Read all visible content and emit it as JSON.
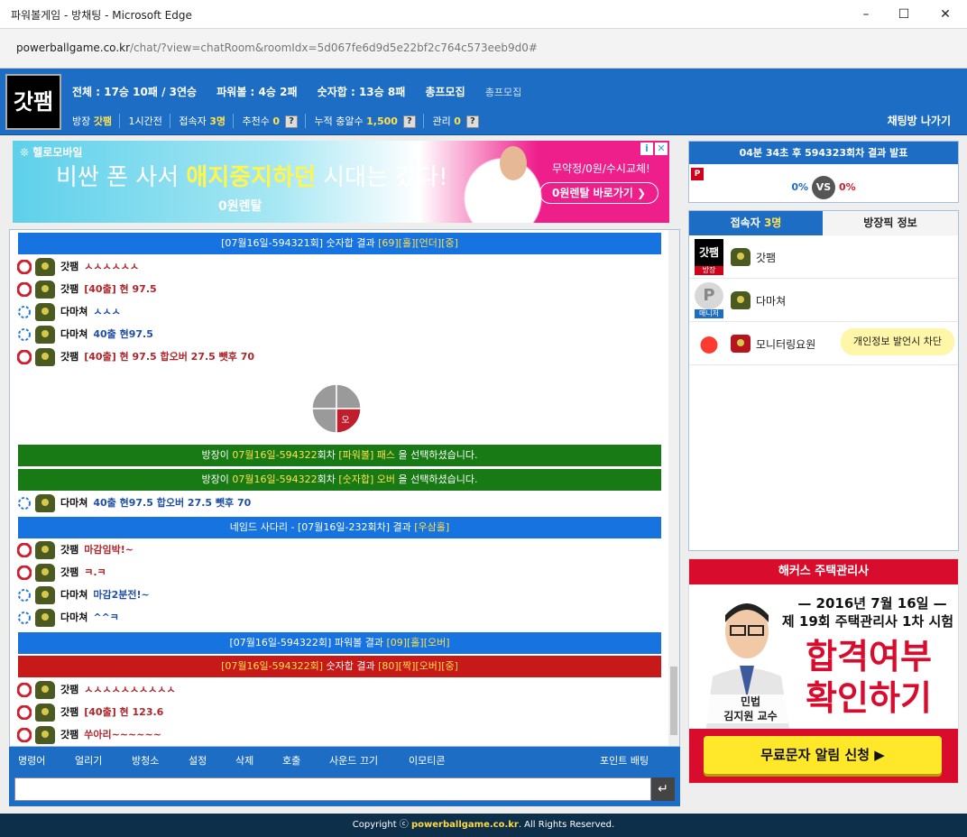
{
  "window": {
    "title": "파워볼게임 - 방채팅 - Microsoft Edge"
  },
  "address": {
    "host": "powerballgame.co.kr",
    "path": "/chat/?view=chatRoom&roomIdx=5d067fe6d9d5e22bf2c764c573eeb9d0#"
  },
  "header": {
    "logo_text": "갓팸",
    "stats": {
      "total": "전체 : 17승 10패 / 3연승",
      "powerball": "파워볼 : 4승 2패",
      "sum": "숫자합 : 13승 8패",
      "recruit": "총프모집",
      "recruit_dim": "총프모집"
    },
    "row2": {
      "host_label": "방장",
      "host_name": "갓팸",
      "time": "1시간전",
      "users_label": "접속자",
      "users_value": "3명",
      "recommend_label": "추천수",
      "recommend_value": "0",
      "cum_label": "누적 충알수",
      "cum_value": "1,500",
      "manage_label": "관리",
      "manage_value": "0",
      "q": "?"
    },
    "leave": "채팅방 나가기"
  },
  "ad_top": {
    "brand": "❊ 헬로모바일",
    "headline_pre": "비싼 폰 사서 ",
    "headline_em": "애지중지하던",
    "headline_post": " 시대는 갔다!",
    "sub": "0원렌탈",
    "right_text": "무약정/0원/수시교체!",
    "button": "0원렌탈 바로가기 ❯",
    "close": "✕"
  },
  "chat": {
    "sys1": {
      "pre": "[07월16일-594321회] 숫자합 결과 ",
      "em": "[69][홀][언더][중]"
    },
    "m1": {
      "name": "갓팸",
      "text": "ㅅㅅㅅㅅㅅㅅ"
    },
    "m2": {
      "name": "갓팸",
      "text": "[40출] 현 97.5"
    },
    "m3": {
      "name": "다마쳐",
      "text": "ㅅㅅㅅ"
    },
    "m4": {
      "name": "다마쳐",
      "text": "40출 현97.5"
    },
    "m5": {
      "name": "갓팸",
      "text": "[40출] 현 97.5  합오버 27.5 뺏후 70"
    },
    "pie_label": "오",
    "sys2": {
      "a": "방장이 ",
      "b": "07월16일-594322",
      "c": "회차 ",
      "d": "[파워볼] 패스",
      "e": " 을 선택하셨습니다."
    },
    "sys3": {
      "a": "방장이 ",
      "b": "07월16일-594322",
      "c": "회차 ",
      "d": "[숫자합] 오버",
      "e": " 을 선택하셨습니다."
    },
    "m6": {
      "name": "다마쳐",
      "text": "40출 현97.5 합오버 27.5 뺏후 70"
    },
    "sys4": {
      "pre": "네임드 사다리 - [07월16일-232회차] 결과 ",
      "em": "[우삼홀]"
    },
    "m7": {
      "name": "갓팸",
      "text": "마감임박!~"
    },
    "m8": {
      "name": "갓팸",
      "text": "ㅋ.ㅋ"
    },
    "m9": {
      "name": "다마쳐",
      "text": "마감2분전!~"
    },
    "m10": {
      "name": "다마쳐",
      "text": "^^ㅋ"
    },
    "sys5": {
      "pre": "[07월16일-594322회] 파워볼 결과 ",
      "em": "[09][홀][오버]"
    },
    "sys6": {
      "pre": "[07월16일-594322회] 숫자합 결과 ",
      "em": "[80][짝][오버][중]"
    },
    "m11": {
      "name": "갓팸",
      "text": "ㅅㅅㅅㅅㅅㅅㅅㅅㅅㅅ"
    },
    "m12": {
      "name": "갓팸",
      "text": "[40출] 현 123.6"
    },
    "m13": {
      "name": "갓팸",
      "text": "쑤아리~~~~~~"
    }
  },
  "toolbar": {
    "cmd": "명령어",
    "freeze": "얼리기",
    "clean": "방청소",
    "settings": "설정",
    "delete": "삭제",
    "call": "호출",
    "sound": "사운드 끄기",
    "emoticon": "이모티콘",
    "betting": "포인트 배팅"
  },
  "input": {
    "send": "↵"
  },
  "result": {
    "header": "04분 34초 후 594323회차 결과 발표",
    "p": "P",
    "left": "0%",
    "vs": "VS",
    "right": "0%"
  },
  "users": {
    "tab_users_label": "접속자 ",
    "tab_users_count": "3명",
    "tab_info": "방장픽 정보",
    "u1": {
      "badge": "방장",
      "avatar_text": "갓팸",
      "name": "갓팸"
    },
    "u2": {
      "badge": "매니저",
      "avatar_text": "P",
      "name": "다마쳐"
    },
    "u3": {
      "name": "모니터링요원",
      "bubble": "개인정보 발언시 차단"
    }
  },
  "ad_right": {
    "brand": "해커스 주택관리사",
    "line1": "— 2016년 7월 16일 —",
    "line2": "제 19회 주택관리사 1차 시험",
    "big1": "합격여부",
    "big2": "확인하기",
    "cap1": "민법",
    "cap2": "김지원 교수",
    "button": "무료문자 알림 신청 ▶"
  },
  "footer": {
    "pre": "Copyright ⓒ ",
    "site": "powerballgame.co.kr",
    "post": ". All Rights Reserved."
  },
  "colors": {
    "brand_blue": "#1e6dc4",
    "sys_blue": "#1673e0",
    "sys_green": "#187a14",
    "sys_red": "#c81919",
    "highlight": "#ffe14d"
  }
}
